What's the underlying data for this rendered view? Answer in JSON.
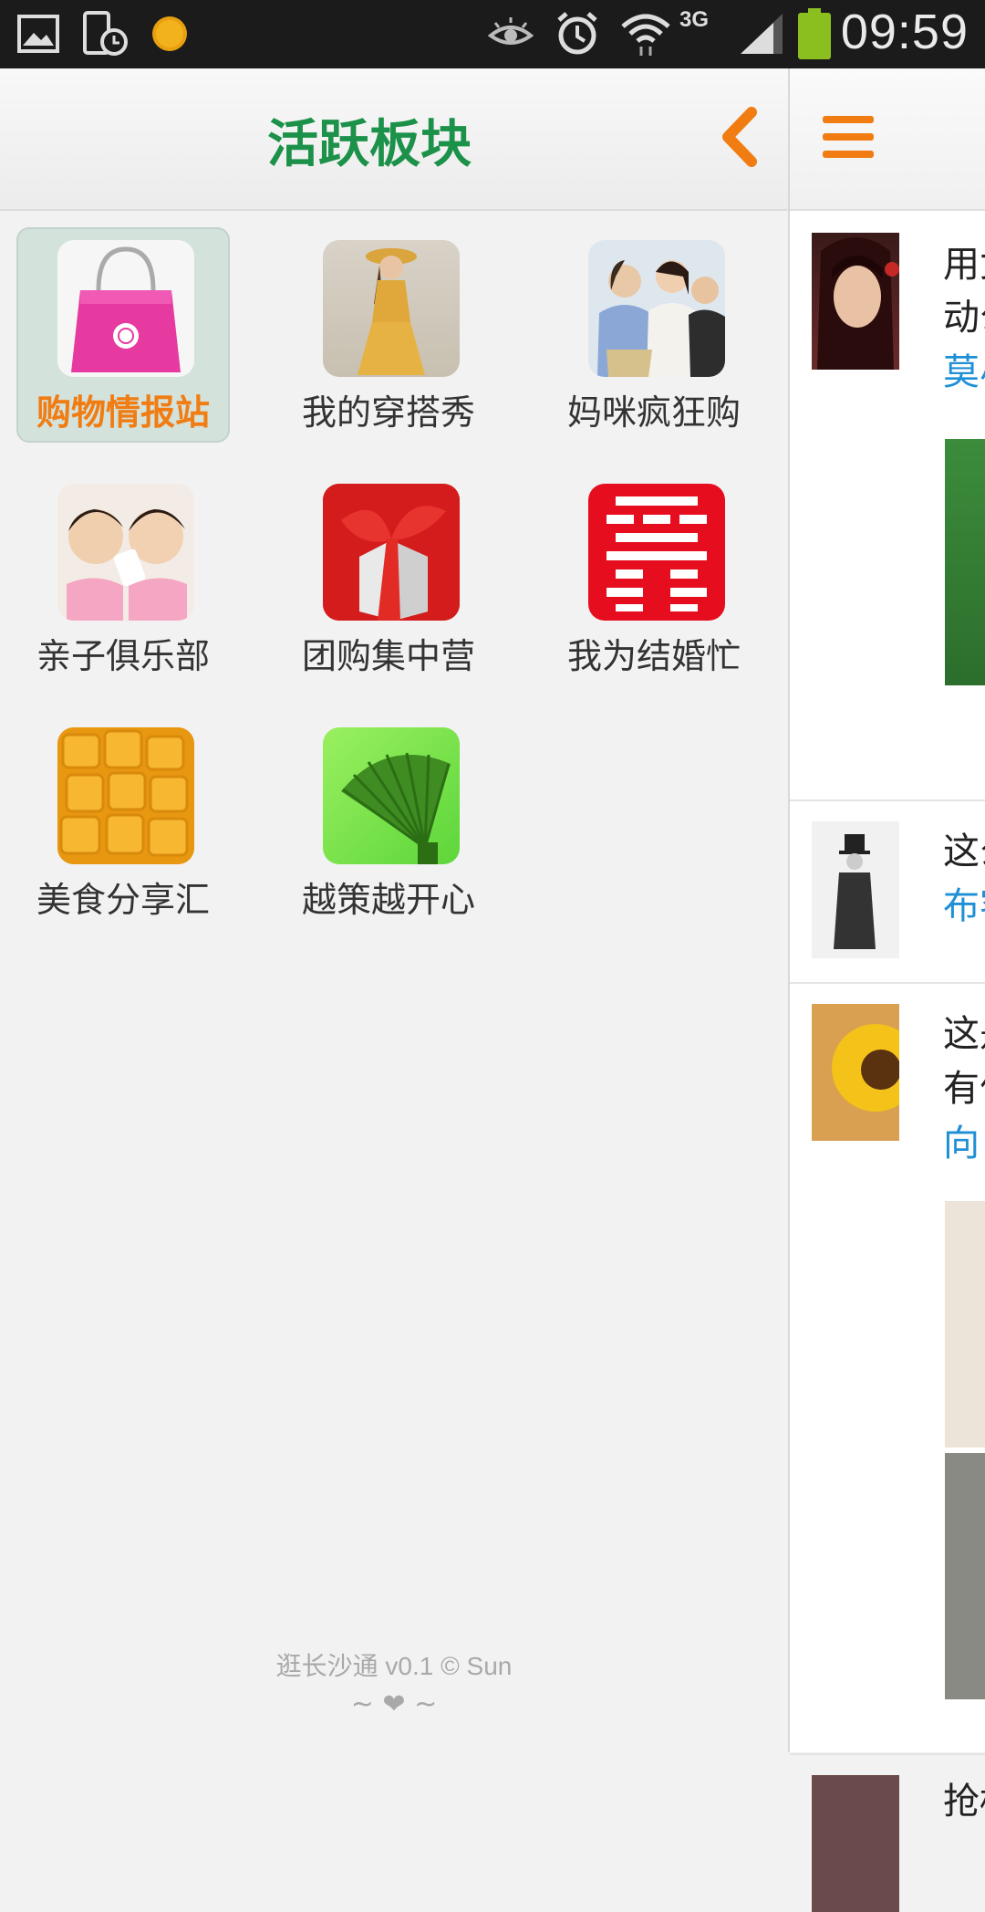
{
  "status_bar": {
    "time": "09:59",
    "network": "3G",
    "icons": [
      "gallery-icon",
      "tablet-clock-icon",
      "sun-badge-icon",
      "eye-icon",
      "alarm-icon",
      "wifi-icon",
      "signal-icon",
      "battery-icon"
    ]
  },
  "drawer": {
    "title": "活跃板块",
    "items": [
      {
        "label": "购物情报站",
        "icon": "shopping-bag-icon",
        "selected": true
      },
      {
        "label": "我的穿搭秀",
        "icon": "fashion-photo",
        "selected": false
      },
      {
        "label": "妈咪疯狂购",
        "icon": "moms-shopping-photo",
        "selected": false
      },
      {
        "label": "亲子俱乐部",
        "icon": "kids-photo",
        "selected": false
      },
      {
        "label": "团购集中营",
        "icon": "gift-box-icon",
        "selected": false
      },
      {
        "label": "我为结婚忙",
        "icon": "double-happiness-icon",
        "selected": false
      },
      {
        "label": "美食分享汇",
        "icon": "mango-photo",
        "selected": false
      },
      {
        "label": "越策越开心",
        "icon": "fan-icon",
        "selected": false
      }
    ],
    "footer_version": "逛长沙通 v0.1 © Sun",
    "footer_heart": "~ ❤ ~"
  },
  "content": {
    "posts": [
      {
        "lines": [
          "用女",
          "动公"
        ],
        "author": "莫小"
      },
      {
        "lines": [
          "这么"
        ],
        "author": "布客"
      },
      {
        "lines": [
          "这是",
          "有何"
        ],
        "author": "向日"
      },
      {
        "lines": [
          "抢标"
        ],
        "author": ""
      }
    ]
  },
  "colors": {
    "accent_orange": "#f07c12",
    "title_green": "#1c9149",
    "link_blue": "#1f8fd6",
    "status_bar": "#1b1b1b"
  }
}
